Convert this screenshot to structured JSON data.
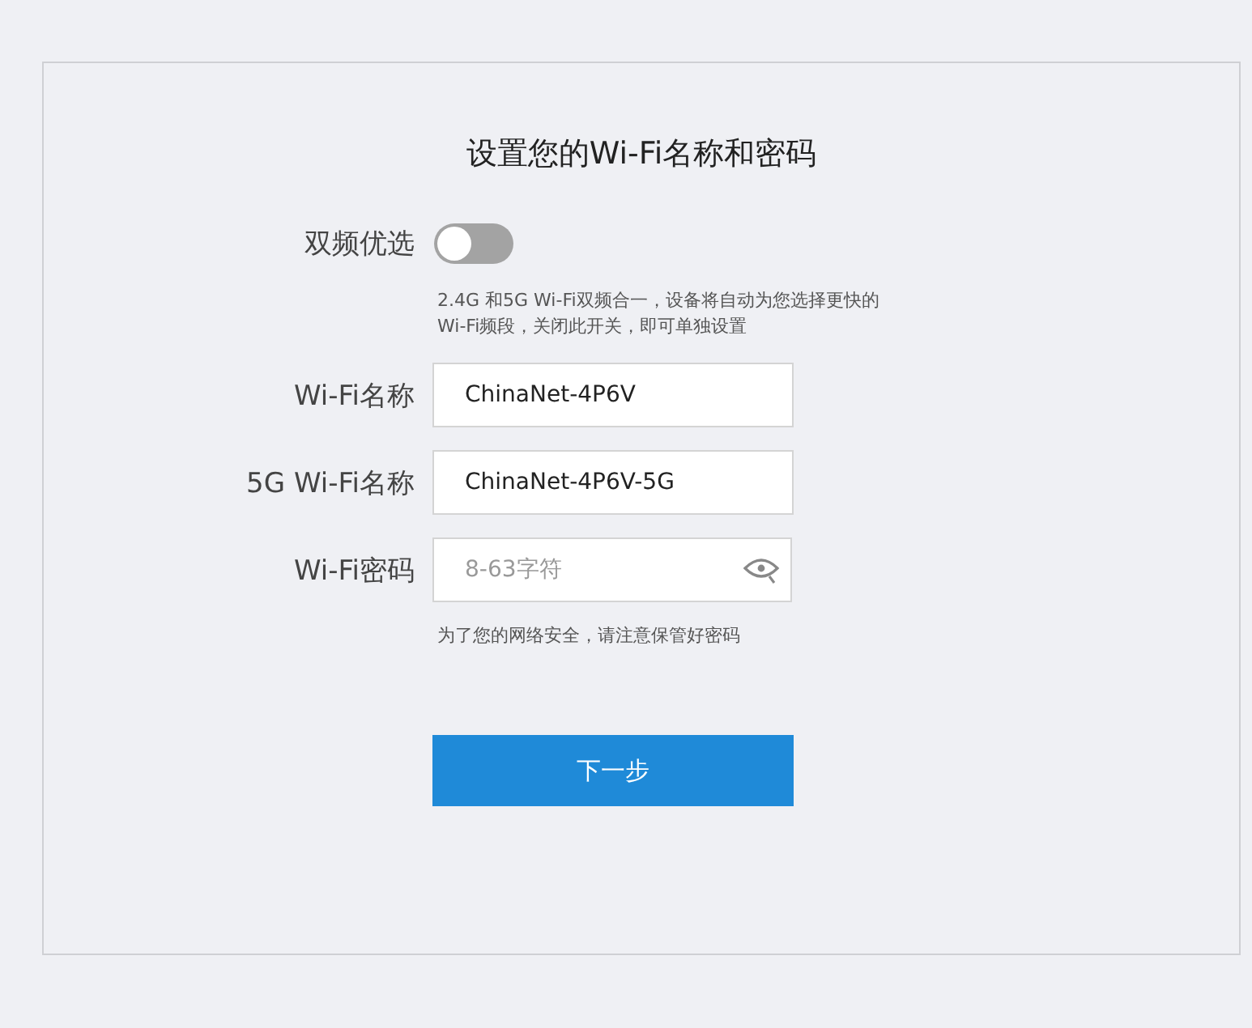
{
  "title": "设置您的Wi-Fi名称和密码",
  "dual_band": {
    "label": "双频优选",
    "on": false,
    "hint": "2.4G 和5G Wi-Fi双频合一，设备将自动为您选择更快的 Wi-Fi频段，关闭此开关，即可单独设置"
  },
  "fields": [
    {
      "label": "Wi-Fi名称",
      "value": "ChinaNet-4P6V",
      "kind": "text"
    },
    {
      "label": "5G Wi-Fi名称",
      "value": "ChinaNet-4P6V-5G",
      "kind": "text"
    },
    {
      "label": "Wi-Fi密码",
      "placeholder": "8-63字符",
      "kind": "password"
    }
  ],
  "password_hint": "为了您的网络安全，请注意保管好密码",
  "next_button": "下一步"
}
